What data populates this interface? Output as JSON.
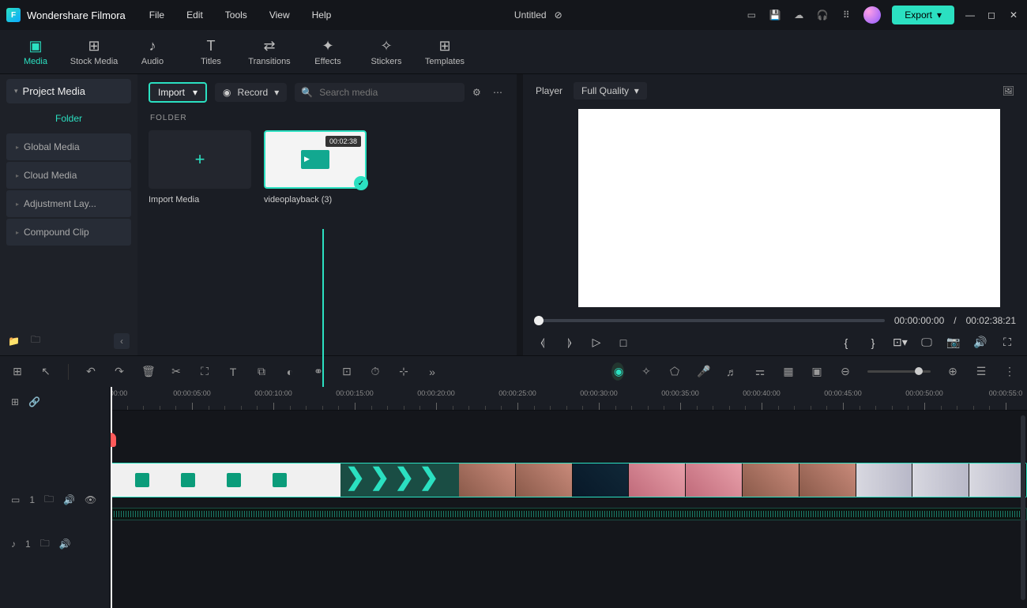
{
  "app": {
    "name": "Wondershare Filmora",
    "title": "Untitled"
  },
  "menus": [
    "File",
    "Edit",
    "Tools",
    "View",
    "Help"
  ],
  "export_label": "Export",
  "tabs": [
    {
      "label": "Media",
      "active": true,
      "icon": "▣"
    },
    {
      "label": "Stock Media",
      "icon": "⊞"
    },
    {
      "label": "Audio",
      "icon": "♪"
    },
    {
      "label": "Titles",
      "icon": "T"
    },
    {
      "label": "Transitions",
      "icon": "⇄"
    },
    {
      "label": "Effects",
      "icon": "✦"
    },
    {
      "label": "Stickers",
      "icon": "✧"
    },
    {
      "label": "Templates",
      "icon": "⊞"
    }
  ],
  "sidebar": {
    "header": "Project Media",
    "folder_label": "Folder",
    "items": [
      "Global Media",
      "Cloud Media",
      "Adjustment Lay...",
      "Compound Clip"
    ]
  },
  "mid": {
    "import_label": "Import",
    "record_label": "Record",
    "search_placeholder": "Search media",
    "folder_section": "FOLDER",
    "import_media": "Import Media",
    "clip": {
      "name": "videoplayback (3)",
      "duration": "00:02:38"
    }
  },
  "player": {
    "tab": "Player",
    "quality": "Full Quality",
    "current": "00:00:00:00",
    "total": "00:02:38:21",
    "sep": "/"
  },
  "ruler": {
    "start": "00:00",
    "marks": [
      "00:00:05:00",
      "00:00:10:00",
      "00:00:15:00",
      "00:00:20:00",
      "00:00:25:00",
      "00:00:30:00",
      "00:00:35:00",
      "00:00:40:00",
      "00:00:45:00",
      "00:00:50:00",
      "00:00:55:0"
    ]
  },
  "tracks": {
    "video": {
      "label": "1"
    },
    "audio": {
      "label": "1"
    }
  }
}
